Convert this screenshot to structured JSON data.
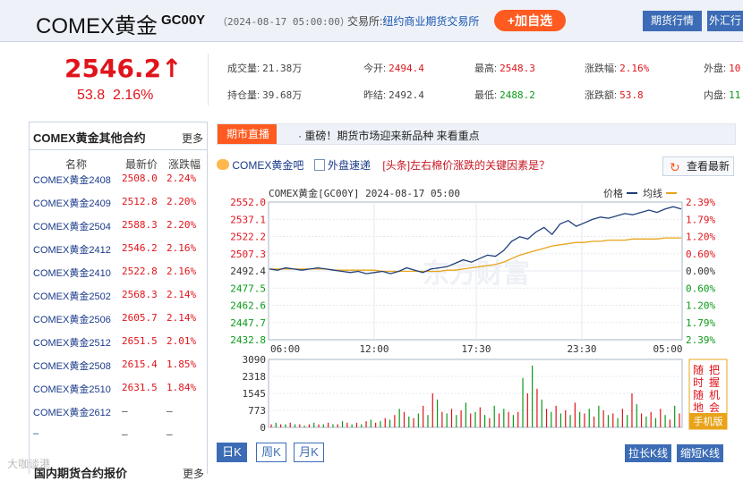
{
  "header": {
    "name": "COMEX黄金",
    "code": "GC00Y",
    "time": "（2024-08-17 05:00:00）",
    "exchange_label": "交易所:",
    "exchange_value": "纽约商业期货交易所",
    "add_button": "+加自选",
    "nav_futures": "期货行情",
    "nav_fx": "外汇行"
  },
  "quote": {
    "price": "2546.2",
    "arrow": "↑",
    "change": "53.8",
    "change_pct": "2.16%",
    "volume_label": "成交量:",
    "volume": "21.38万",
    "open_label": "今开:",
    "open": "2494.4",
    "high_label": "最高:",
    "high": "2548.3",
    "pct_label": "涨跌幅:",
    "pct": "2.16%",
    "outer_label": "外盘:",
    "outer": "10",
    "oi_label": "持仓量:",
    "oi": "39.68万",
    "prev_label": "昨结:",
    "prev": "2492.4",
    "low_label": "最低:",
    "low": "2488.2",
    "amt_label": "涨跌额:",
    "amt": "53.8",
    "inner_label": "内盘:",
    "inner": "11"
  },
  "left": {
    "title": "COMEX黄金其他合约",
    "more": "更多",
    "headers": [
      "名称",
      "最新价",
      "涨跌幅"
    ],
    "rows": [
      [
        "COMEX黄金2408",
        "2508.0",
        "2.24%"
      ],
      [
        "COMEX黄金2409",
        "2512.8",
        "2.20%"
      ],
      [
        "COMEX黄金2504",
        "2588.3",
        "2.20%"
      ],
      [
        "COMEX黄金2412",
        "2546.2",
        "2.16%"
      ],
      [
        "COMEX黄金2410",
        "2522.8",
        "2.16%"
      ],
      [
        "COMEX黄金2502",
        "2568.3",
        "2.14%"
      ],
      [
        "COMEX黄金2506",
        "2605.7",
        "2.14%"
      ],
      [
        "COMEX黄金2512",
        "2651.5",
        "2.01%"
      ],
      [
        "COMEX黄金2508",
        "2615.4",
        "1.85%"
      ],
      [
        "COMEX黄金2510",
        "2631.5",
        "1.84%"
      ],
      [
        "COMEX黄金2612",
        "–",
        "–"
      ],
      [
        "–",
        "–",
        "–"
      ]
    ],
    "bottom_title": "国内期货合约报价",
    "bottom_more": "更多"
  },
  "news": {
    "tag": "期市直播",
    "text": "· 重磅！期货市场迎来新品种 来看重点"
  },
  "links": {
    "bar": "COMEX黄金吧",
    "fast": "外盘速递",
    "headline": "[头条]左右棉价涨跌的关键因素是？",
    "refresh": "查看最新"
  },
  "chart": {
    "caption": "COMEX黄金[GC00Y] 2024-08-17 05:00",
    "legend_price": "价格",
    "legend_avg": "均线",
    "price_ticks": [
      "2552.0",
      "2537.1",
      "2522.2",
      "2507.3",
      "2492.4",
      "2477.5",
      "2462.6",
      "2447.7",
      "2432.8"
    ],
    "pct_ticks": [
      "2.39%",
      "1.79%",
      "1.20%",
      "0.60%",
      "0.00%",
      "0.60%",
      "1.20%",
      "1.79%",
      "2.39%"
    ],
    "time_ticks": [
      "06:00",
      "12:00",
      "17:30",
      "23:30",
      "05:00"
    ],
    "vol_ticks": [
      "3090",
      "2318",
      "1545",
      "773",
      "0"
    ],
    "side_ad": "随时随地",
    "side_ad2": "把握机会",
    "side_ad3": "手机版",
    "watermark": "东方财富"
  },
  "chart_data": {
    "type": "line",
    "title": "COMEX黄金[GC00Y] 2024-08-17 05:00",
    "series": [
      {
        "name": "价格",
        "values": [
          2494,
          2493,
          2495,
          2494,
          2493,
          2494,
          2495,
          2494,
          2493,
          2492,
          2491,
          2492,
          2490,
          2491,
          2492,
          2490,
          2492,
          2495,
          2493,
          2491,
          2494,
          2495,
          2496,
          2499,
          2502,
          2500,
          2503,
          2506,
          2505,
          2510,
          2518,
          2522,
          2520,
          2526,
          2530,
          2524,
          2533,
          2536,
          2531,
          2534,
          2537,
          2539,
          2538,
          2540,
          2542,
          2541,
          2543,
          2545,
          2543,
          2546,
          2548,
          2546
        ]
      },
      {
        "name": "均线",
        "values": [
          2494,
          2494,
          2494,
          2494,
          2494,
          2494,
          2494,
          2494,
          2493,
          2493,
          2493,
          2493,
          2493,
          2493,
          2492,
          2492,
          2492,
          2492,
          2492,
          2492,
          2492,
          2492,
          2493,
          2493,
          2494,
          2495,
          2496,
          2497,
          2498,
          2500,
          2503,
          2506,
          2508,
          2510,
          2512,
          2514,
          2515,
          2516,
          2517,
          2517,
          2518,
          2518,
          2519,
          2519,
          2519,
          2520,
          2520,
          2520,
          2520,
          2521,
          2521,
          2521
        ]
      }
    ],
    "ylim": [
      2432.8,
      2552.0
    ],
    "x_ticks": [
      "06:00",
      "12:00",
      "17:30",
      "23:30",
      "05:00"
    ]
  },
  "tabs": [
    "日K",
    "周K",
    "月K"
  ],
  "kbtns": [
    "拉长K线",
    "缩短K线"
  ],
  "watermark": "大咖谈港"
}
